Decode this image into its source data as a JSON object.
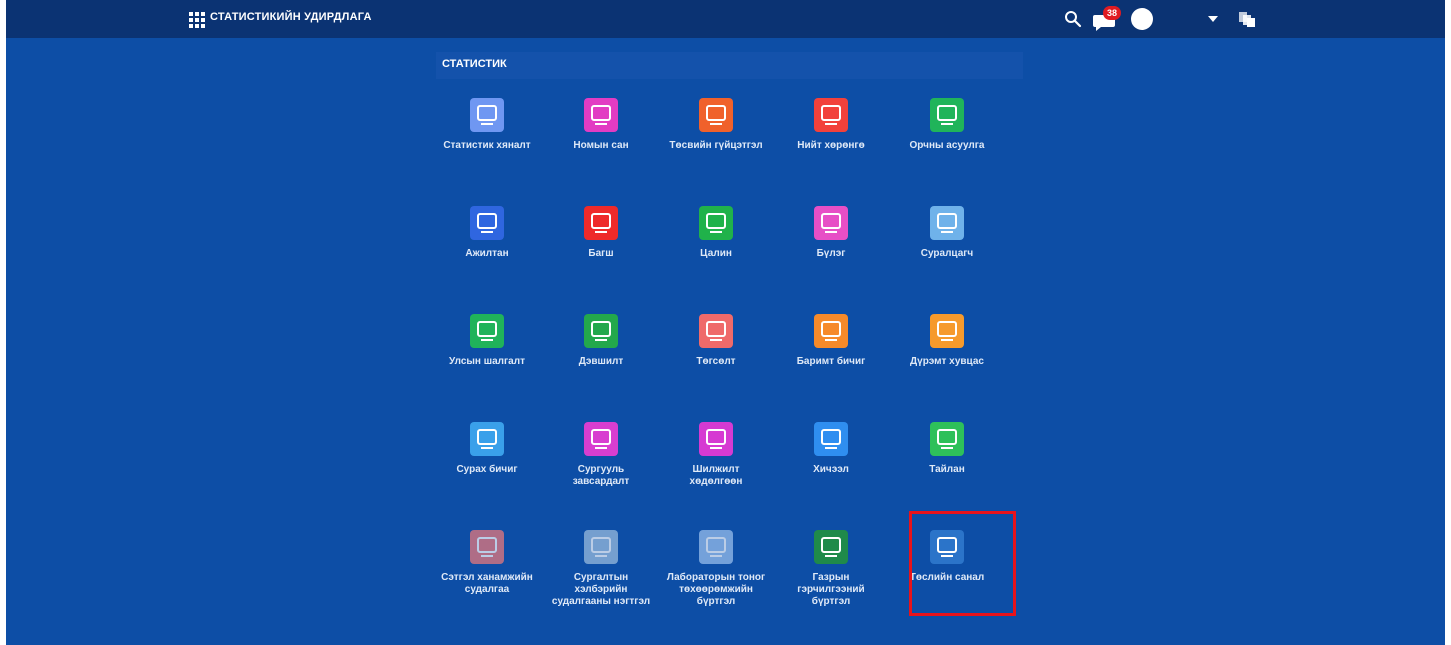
{
  "header": {
    "title": "СТАТИСТИКИЙН УДИРДЛАГА",
    "notification_count": "38"
  },
  "section": {
    "title": "СТАТИСТИК"
  },
  "tiles": [
    {
      "label": "Статистик хяналт",
      "color": "#6f97f2",
      "icon": "flowchart-check-icon"
    },
    {
      "label": "Номын сан",
      "color": "#e23cc3",
      "icon": "library-icon"
    },
    {
      "label": "Төсвийн гүйцэтгэл",
      "color": "#f0612b",
      "icon": "budget-chart-icon"
    },
    {
      "label": "Нийт хөрөнгө",
      "color": "#f2413b",
      "icon": "asset-list-icon"
    },
    {
      "label": "Орчны асуулга",
      "color": "#20b45a",
      "icon": "building-icon"
    },
    {
      "label": "Ажилтан",
      "color": "#2f66e0",
      "icon": "staff-icon"
    },
    {
      "label": "Багш",
      "color": "#ee2a2a",
      "icon": "teacher-icon"
    },
    {
      "label": "Цалин",
      "color": "#20b24a",
      "icon": "money-icon"
    },
    {
      "label": "Бүлэг",
      "color": "#e74fc6",
      "icon": "group-icon"
    },
    {
      "label": "Суралцагч",
      "color": "#6fb2ea",
      "icon": "student-icon"
    },
    {
      "label": "Улсын шалгалт",
      "color": "#20b35a",
      "icon": "exam-icon"
    },
    {
      "label": "Дэвшилт",
      "color": "#23a84c",
      "icon": "progress-icon"
    },
    {
      "label": "Төгсөлт",
      "color": "#ef6a6a",
      "icon": "graduation-icon"
    },
    {
      "label": "Баримт бичиг",
      "color": "#f68a2a",
      "icon": "document-icon"
    },
    {
      "label": "Дүрэмт хувцас",
      "color": "#f69a2c",
      "icon": "uniform-document-icon"
    },
    {
      "label": "Сурах бичиг",
      "color": "#3aa0ea",
      "icon": "textbook-icon"
    },
    {
      "label": "Сургууль завсардалт",
      "color": "#d83ed0",
      "icon": "dropout-icon"
    },
    {
      "label": "Шилжилт хөдөлгөөн",
      "color": "#d63ad2",
      "icon": "transfer-icon"
    },
    {
      "label": "Хичээл",
      "color": "#2f8ef0",
      "icon": "book-icon"
    },
    {
      "label": "Тайлан",
      "color": "#2ec05a",
      "icon": "report-icon"
    },
    {
      "label": "Сэтгэл ханамжийн судалгаа",
      "color": "#ee7a7a",
      "icon": "satisfaction-survey-icon"
    },
    {
      "label": "Сургалтын хэлбэрийн судалгааны нэгтгэл",
      "color": "#9dbfe0",
      "icon": "training-survey-icon"
    },
    {
      "label": "Лабораторын тоног төхөөрөмжийн бүртгэл",
      "color": "#9cc2ee",
      "icon": "lab-equipment-icon"
    },
    {
      "label": "Газрын гэрчилгээний бүртгэл",
      "color": "#1f8a4a",
      "icon": "land-certificate-icon"
    },
    {
      "label": "Төслийн санал",
      "color": "#2b74c9",
      "icon": "project-proposal-icon"
    }
  ],
  "colors": {
    "background": "#0d4ea6",
    "topbar": "#0b3373",
    "highlight": "#e8131b",
    "badge": "#e01b22"
  }
}
